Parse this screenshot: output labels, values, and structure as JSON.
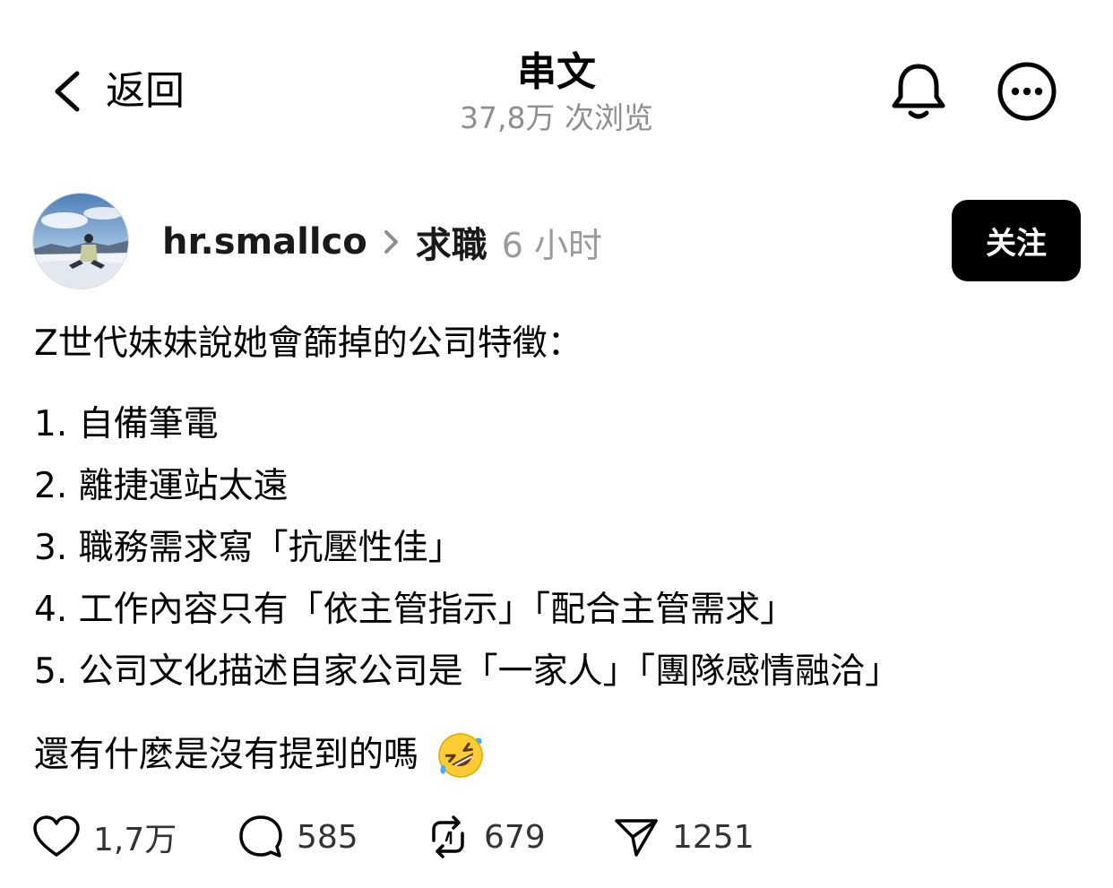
{
  "header": {
    "back_label": "返回",
    "title": "串文",
    "views": "37,8万 次浏览"
  },
  "author": {
    "username": "hr.smallco",
    "topic": "求職",
    "time": "6 小时",
    "follow_label": "关注"
  },
  "post": {
    "intro": "Z世代妹妹說她會篩掉的公司特徵：",
    "items": [
      "1. 自備筆電",
      "2. 離捷運站太遠",
      "3. 職務需求寫「抗壓性佳」",
      "4. 工作內容只有「依主管指示」「配合主管需求」",
      "5. 公司文化描述自家公司是「一家人」「團隊感情融洽」"
    ],
    "outro": "還有什麼是沒有提到的嗎",
    "emoji": "rolling-on-floor-laughing"
  },
  "actions": {
    "likes": "1,7万",
    "comments": "585",
    "reposts": "679",
    "shares": "1251"
  },
  "icons": {
    "back": "chevron-left-icon",
    "bell": "bell-icon",
    "more": "more-icon",
    "separator": "chevron-right-icon",
    "like": "heart-icon",
    "comment": "comment-icon",
    "repost": "repost-icon",
    "share": "send-icon"
  },
  "colors": {
    "text": "#000000",
    "muted": "#8e8e8e",
    "button_bg": "#000000",
    "button_text": "#ffffff"
  }
}
